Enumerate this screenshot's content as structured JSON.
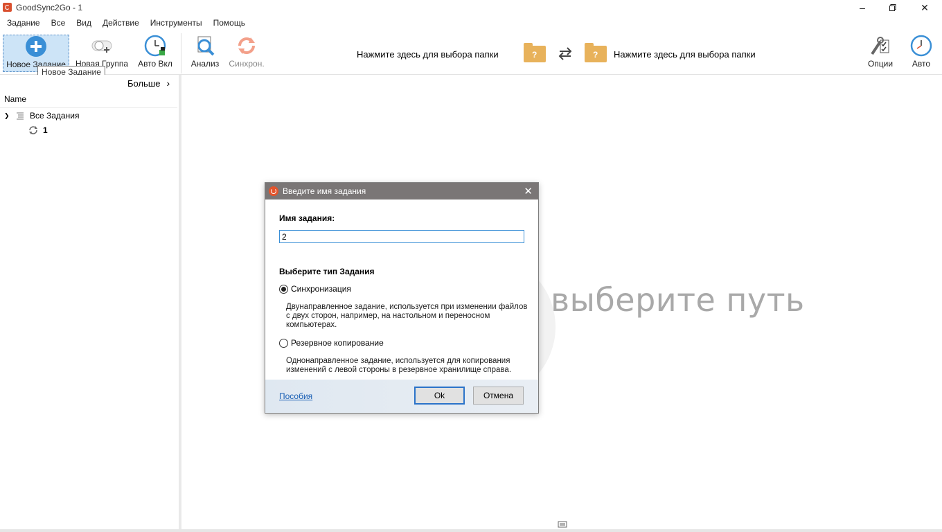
{
  "window": {
    "title": "GoodSync2Go - 1"
  },
  "menu": [
    "Задание",
    "Все",
    "Вид",
    "Действие",
    "Инструменты",
    "Помощь"
  ],
  "toolbar": {
    "new_job": "Новое Задание",
    "new_group": "Новая Группа",
    "auto_on": "Авто Вкл",
    "analyze": "Анализ",
    "sync": "Синхрон.",
    "left_folder_hint": "Нажмите здесь для выбора папки",
    "right_folder_hint": "Нажмите здесь для выбора папки",
    "options": "Опции",
    "auto": "Авто",
    "tooltip": "Новое Задание"
  },
  "left_panel": {
    "more": "Больше",
    "column_name": "Name",
    "all_jobs": "Все Задания",
    "jobs": [
      "1"
    ]
  },
  "main": {
    "watermark": "выберите путь"
  },
  "dialog": {
    "title": "Введите имя задания",
    "name_label": "Имя задания:",
    "name_value": "2",
    "type_label": "Выберите тип Задания",
    "sync_option": "Синхронизация",
    "sync_desc": "Двунаправленное задание, используется при изменении файлов с двух сторон, например, на настольном и переносном компьютерах.",
    "backup_option": "Резервное копирование",
    "backup_desc": "Однонаправленное задание, используется для копирования изменений с левой стороны в резервное хранилище справа.",
    "help_link": "Пособия",
    "ok": "Ok",
    "cancel": "Отмена",
    "selected": "sync"
  },
  "colors": {
    "accent": "#3a8fd6",
    "folder": "#e8b25b",
    "dialog_title": "#7a7676"
  }
}
